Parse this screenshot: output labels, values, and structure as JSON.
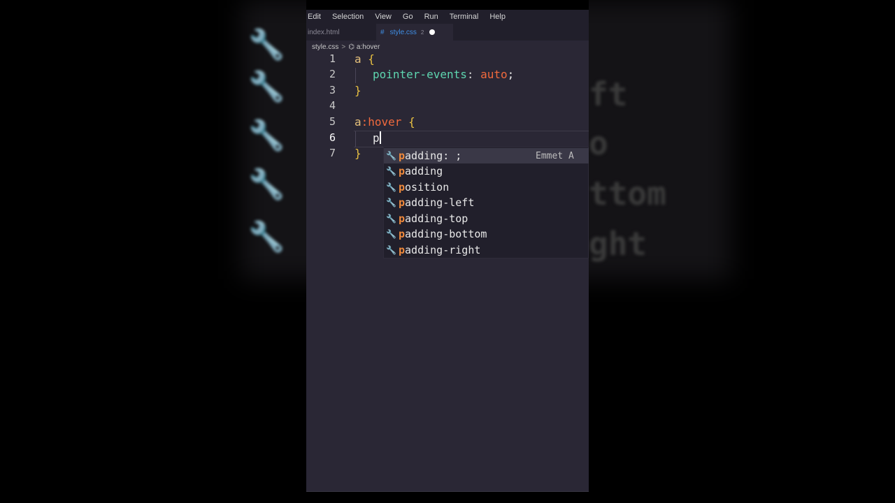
{
  "menu": [
    "Edit",
    "Selection",
    "View",
    "Go",
    "Run",
    "Terminal",
    "Help"
  ],
  "tabs": {
    "inactive": "index.html",
    "active_icon": "#",
    "active": "style.css",
    "active_problems": "2"
  },
  "breadcrumb": {
    "file": "style.css",
    "separator": ">",
    "symbol_icon": "symbol-icon",
    "symbol": "a:hover"
  },
  "code": {
    "line_numbers": [
      "1",
      "2",
      "3",
      "4",
      "5",
      "6",
      "7"
    ],
    "line1": {
      "selector": "a",
      "brace": "{"
    },
    "line2": {
      "property": "pointer-events",
      "colon": ":",
      "value": "auto",
      "semicolon": ";"
    },
    "line3": {
      "brace": "}"
    },
    "line5": {
      "selector": "a",
      "pseudo": ":hover",
      "brace": "{"
    },
    "line6": {
      "typed": "p"
    },
    "line7": {
      "brace": "}"
    }
  },
  "suggestions": [
    {
      "match": "p",
      "rest": "adding: ;",
      "detail": "Emmet A",
      "icon": "wrench-icon",
      "selected": true
    },
    {
      "match": "p",
      "rest": "adding",
      "icon": "wrench-icon"
    },
    {
      "match": "p",
      "rest": "osition",
      "icon": "wrench-icon"
    },
    {
      "match": "p",
      "rest": "adding-left",
      "icon": "wrench-icon"
    },
    {
      "match": "p",
      "rest": "adding-top",
      "icon": "wrench-icon"
    },
    {
      "match": "p",
      "rest": "adding-bottom",
      "icon": "wrench-icon"
    },
    {
      "match": "p",
      "rest": "adding-right",
      "icon": "wrench-icon"
    }
  ],
  "background_echo": [
    "ft",
    "o",
    "ttom",
    "ght"
  ],
  "colors": {
    "editor_bg": "#2a2735",
    "property": "#5ed6b0",
    "value": "#f26a3d",
    "brace": "#e8c042",
    "match": "#f08a3c",
    "tab_active": "#3f8fe6"
  }
}
